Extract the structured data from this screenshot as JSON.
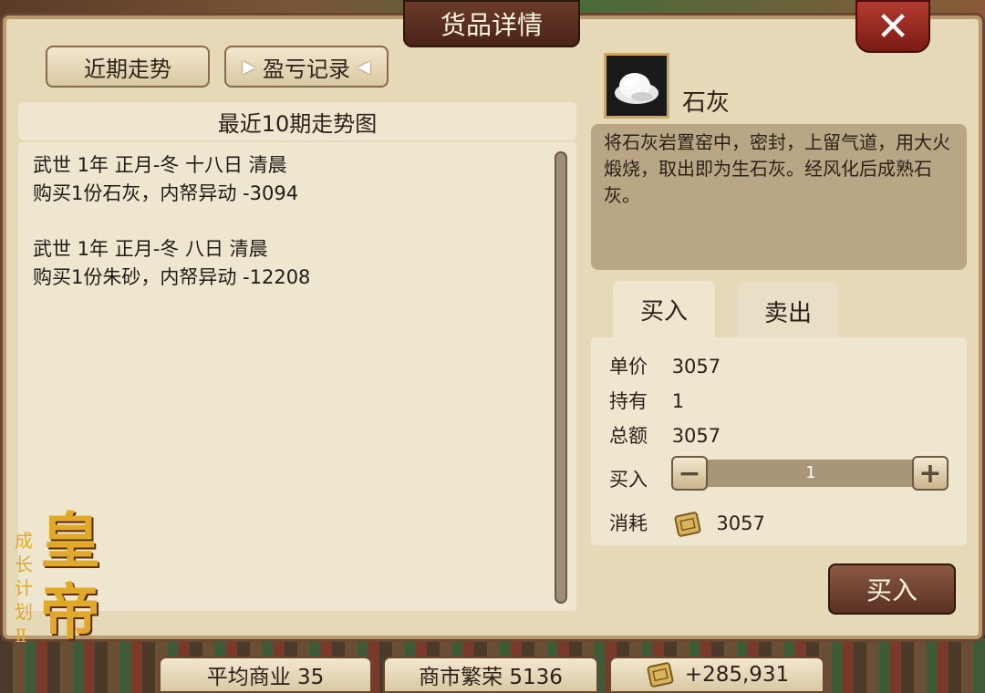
{
  "window": {
    "title": "货品详情",
    "close_symbol": "✕"
  },
  "tabs": {
    "trend_label": "近期走势",
    "record_label": "盈亏记录"
  },
  "chart": {
    "header": "最近10期走势图"
  },
  "log": [
    {
      "line1": "武世 1年 正月-冬 十八日 清晨",
      "line2": "购买1份石灰，内帑异动 -3094"
    },
    {
      "line1": "武世 1年 正月-冬 八日 清晨",
      "line2": "购买1份朱砂，内帑异动 -12208"
    }
  ],
  "item": {
    "name": "石灰",
    "icon": "lime-powder-icon",
    "description": "将石灰岩置窑中，密封，上留气道，用大火煅烧，取出即为生石灰。经风化后成熟石灰。"
  },
  "trade": {
    "buy_tab": "买入",
    "sell_tab": "卖出",
    "unit_price_label": "单价",
    "unit_price": "3057",
    "held_label": "持有",
    "held": "1",
    "total_label": "总额",
    "total": "3057",
    "qty_label": "买入",
    "qty": "1",
    "minus_symbol": "−",
    "plus_symbol": "+",
    "cost_label": "消耗",
    "cost": "3057",
    "buy_button": "买入"
  },
  "status_bar": {
    "avg_commerce": "平均商业  35",
    "market_prosperity": "商市繁荣  5136",
    "treasury": "+285,931"
  },
  "logo": {
    "big_text_1": "皇",
    "big_text_2": "帝",
    "small_text": "成长计划Ⅱ"
  },
  "colors": {
    "accent": "#6a3b2a",
    "panel": "#efe6d0",
    "close": "#b43a2e",
    "logo_gold": "#e0a92a"
  }
}
